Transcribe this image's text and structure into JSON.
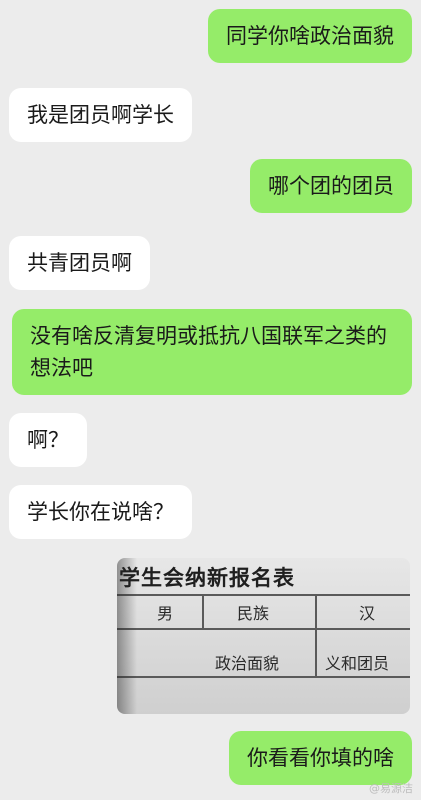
{
  "messages": [
    {
      "side": "right",
      "text": "同学你啥政治面貌"
    },
    {
      "side": "left",
      "text": "我是团员啊学长"
    },
    {
      "side": "right",
      "text": "哪个团的团员"
    },
    {
      "side": "left",
      "text": "共青团员啊"
    },
    {
      "side": "right",
      "text": "没有啥反清复明或抵抗八国联军之类的想法吧"
    },
    {
      "side": "left",
      "text": "啊？"
    },
    {
      "side": "left",
      "text": "学长你在说啥？"
    },
    {
      "side": "right",
      "text": "你看看你填的啥"
    }
  ],
  "form_image": {
    "title": "学生会纳新报名表",
    "row1": {
      "gender": "男",
      "ethnicity_label": "民族",
      "ethnicity_value": "汉"
    },
    "row2": {
      "political_label": "政治面貌",
      "political_value": "义和团员"
    }
  },
  "watermark": "@易源洁",
  "colors": {
    "background": "#ececec",
    "outgoing_bubble": "#95ec69",
    "incoming_bubble": "#ffffff"
  }
}
